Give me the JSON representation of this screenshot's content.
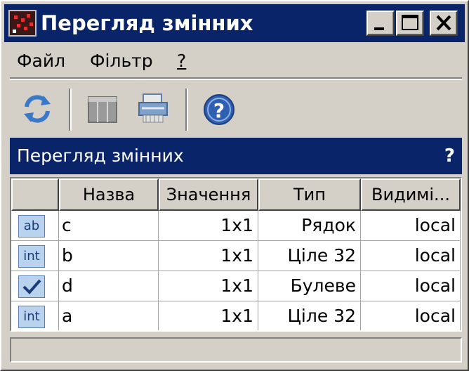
{
  "window": {
    "title": "Перегляд змінних",
    "icons": {
      "app": "app-icon",
      "minimize": "minimize-icon",
      "maximize": "maximize-icon",
      "close": "close-icon"
    }
  },
  "menu": {
    "file": "Файл",
    "filter": "Фільтр",
    "help": "?"
  },
  "toolbar": {
    "icons": [
      "refresh-icon",
      "columns-icon",
      "print-icon",
      "help-icon"
    ]
  },
  "panel": {
    "title": "Перегляд змінних",
    "help": "?"
  },
  "table": {
    "headers": [
      "",
      "Назва",
      "Значення",
      "Тип",
      "Видимі..."
    ],
    "rows": [
      {
        "icon_label": "ab",
        "icon": "string-type-icon",
        "name": "c",
        "value": "1x1",
        "type": "Рядок",
        "visibility": "local"
      },
      {
        "icon_label": "int",
        "icon": "int-type-icon",
        "name": "b",
        "value": "1x1",
        "type": "Ціле 32",
        "visibility": "local"
      },
      {
        "icon_label": "",
        "icon": "bool-type-icon",
        "name": "d",
        "value": "1x1",
        "type": "Булеве",
        "visibility": "local"
      },
      {
        "icon_label": "int",
        "icon": "int-type-icon",
        "name": "a",
        "value": "1x1",
        "type": "Ціле 32",
        "visibility": "local"
      }
    ]
  },
  "statusbar": {
    "text": ""
  },
  "colors": {
    "title_bar": "#0a246a",
    "face": "#d4d0c8",
    "panel_header": "#0a246a"
  }
}
